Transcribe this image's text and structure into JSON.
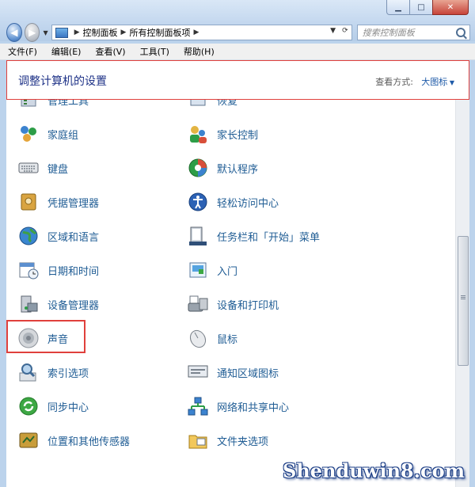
{
  "address_bar": {
    "crumbs": [
      "控制面板",
      "所有控制面板项"
    ]
  },
  "search": {
    "placeholder": "搜索控制面板"
  },
  "menu": [
    "文件(F)",
    "编辑(E)",
    "查看(V)",
    "工具(T)",
    "帮助(H)"
  ],
  "header": {
    "title": "调整计算机的设置",
    "view_by_label": "查看方式:",
    "view_by_value": "大图标"
  },
  "items_left": [
    {
      "label": "管理工具",
      "icon": "admin-tools-icon"
    },
    {
      "label": "家庭组",
      "icon": "homegroup-icon"
    },
    {
      "label": "键盘",
      "icon": "keyboard-icon"
    },
    {
      "label": "凭据管理器",
      "icon": "credential-manager-icon"
    },
    {
      "label": "区域和语言",
      "icon": "globe-icon"
    },
    {
      "label": "日期和时间",
      "icon": "calendar-clock-icon"
    },
    {
      "label": "设备管理器",
      "icon": "device-manager-icon"
    },
    {
      "label": "声音",
      "icon": "speaker-icon"
    },
    {
      "label": "索引选项",
      "icon": "indexing-icon"
    },
    {
      "label": "同步中心",
      "icon": "sync-icon"
    },
    {
      "label": "位置和其他传感器",
      "icon": "sensor-icon"
    }
  ],
  "items_right": [
    {
      "label": "恢复",
      "icon": "recovery-icon"
    },
    {
      "label": "家长控制",
      "icon": "parental-controls-icon"
    },
    {
      "label": "默认程序",
      "icon": "default-programs-icon"
    },
    {
      "label": "轻松访问中心",
      "icon": "ease-of-access-icon"
    },
    {
      "label": "任务栏和「开始」菜单",
      "icon": "taskbar-icon"
    },
    {
      "label": "入门",
      "icon": "getting-started-icon"
    },
    {
      "label": "设备和打印机",
      "icon": "printer-icon"
    },
    {
      "label": "鼠标",
      "icon": "mouse-icon"
    },
    {
      "label": "通知区域图标",
      "icon": "notification-area-icon"
    },
    {
      "label": "网络和共享中心",
      "icon": "network-icon"
    },
    {
      "label": "文件夹选项",
      "icon": "folder-options-icon"
    }
  ],
  "watermark": "Shenduwin8.com"
}
